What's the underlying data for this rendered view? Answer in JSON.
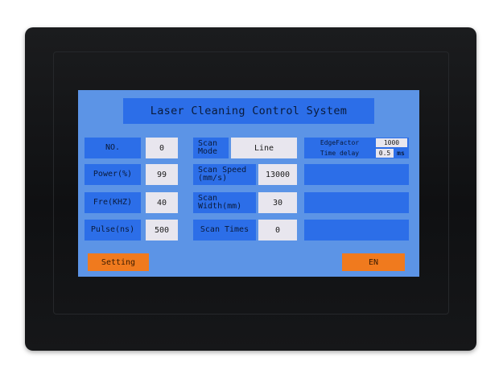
{
  "header": {
    "title": "Laser Cleaning Control System"
  },
  "params": {
    "no": {
      "label": "NO.",
      "value": "0"
    },
    "power": {
      "label": "Power(%)",
      "value": "99"
    },
    "fre": {
      "label": "Fre(KHZ)",
      "value": "40"
    },
    "pulse": {
      "label": "Pulse(ns)",
      "value": "500"
    },
    "scan_mode": {
      "label_1": "Scan",
      "label_2": "Mode",
      "value": "Line"
    },
    "scan_speed": {
      "label_1": "Scan Speed",
      "label_2": "(mm/s)",
      "value": "13000"
    },
    "scan_width": {
      "label_1": "Scan",
      "label_2": "Width(mm)",
      "value": "30"
    },
    "scan_times": {
      "label": "Scan Times",
      "value": "0"
    }
  },
  "right_panel": {
    "edge_factor": {
      "label": "EdgeFactor",
      "value": "1000"
    },
    "time_delay": {
      "label": "Time delay",
      "value": "0.5",
      "unit": "ms"
    }
  },
  "buttons": {
    "setting": "Setting",
    "language": "EN"
  },
  "colors": {
    "screen_bg": "#5c94e6",
    "label_bg": "#2c6ee8",
    "value_bg": "#e8e6ee",
    "button_bg": "#f07a1e",
    "bezel": "#141517"
  }
}
